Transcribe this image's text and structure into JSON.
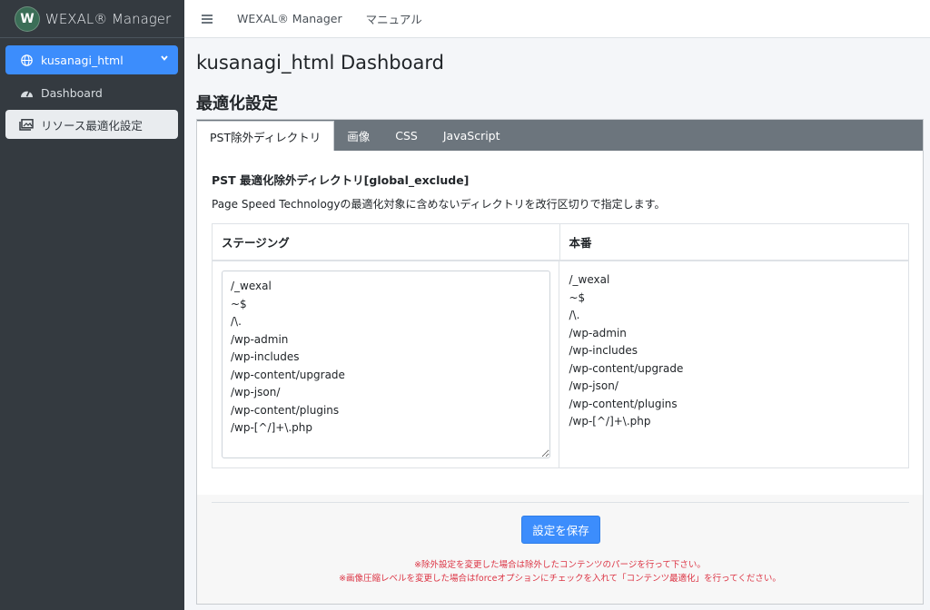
{
  "brand": {
    "logo_letter": "W",
    "name": "WEXAL® Manager"
  },
  "sidebar": {
    "site": {
      "label": "kusanagi_html",
      "icon": "globe-icon"
    },
    "items": [
      {
        "label": "Dashboard",
        "icon": "tachometer-icon"
      },
      {
        "label": "リソース最適化設定",
        "icon": "images-icon",
        "active": true
      }
    ]
  },
  "topbar": {
    "links": [
      "WEXAL® Manager",
      "マニュアル"
    ]
  },
  "page": {
    "title": "kusanagi_html Dashboard",
    "section": "最適化設定"
  },
  "tabs": [
    "PST除外ディレクトリ",
    "画像",
    "CSS",
    "JavaScript"
  ],
  "field": {
    "title": "PST 最適化除外ディレクトリ[global_exclude]",
    "description": "Page Speed Technologyの最適化対象に含めないディレクトリを改行区切りで指定します。"
  },
  "compare": {
    "staging_header": "ステージング",
    "production_header": "本番",
    "staging_value": "/_wexal\n~$\n/\\.\n/wp-admin\n/wp-includes\n/wp-content/upgrade\n/wp-json/\n/wp-content/plugins\n/wp-[^/]+\\.php",
    "production_lines": [
      "/_wexal",
      "~$",
      "/\\.",
      "/wp-admin",
      "/wp-includes",
      "/wp-content/upgrade",
      "/wp-json/",
      "/wp-content/plugins",
      "/wp-[^/]+\\.php"
    ]
  },
  "footer": {
    "save_label": "設定を保存",
    "notes": [
      "※除外設定を変更した場合は除外したコンテンツのパージを行って下さい。",
      "※画像圧縮レベルを変更した場合はforceオプションにチェックを入れて「コンテンツ最適化」を行ってください。"
    ]
  },
  "colors": {
    "sidebar": "#343a40",
    "accent": "#3c8dfc",
    "tabbar": "#6c757d",
    "note": "#dc3545"
  }
}
